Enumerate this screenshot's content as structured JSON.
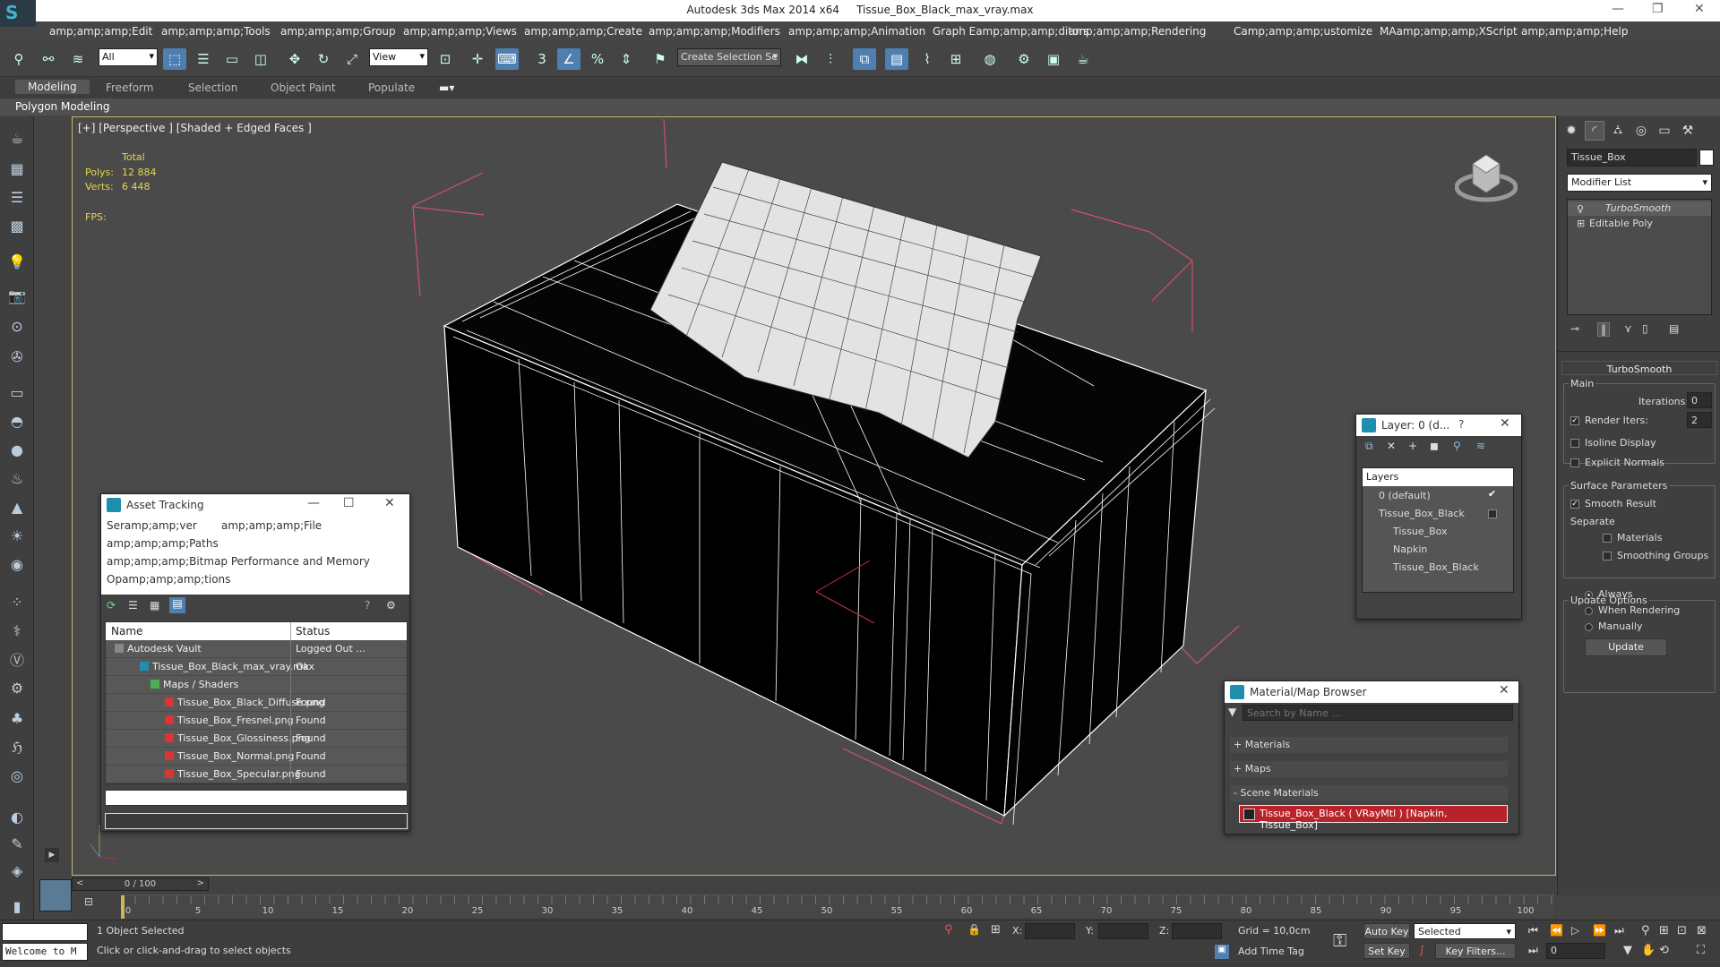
{
  "window": {
    "app_title": "Autodesk 3ds Max  2014 x64",
    "file_title": "Tissue_Box_Black_max_vray.max"
  },
  "menu": [
    "amp;amp;amp;Edit",
    "amp;amp;amp;Tools",
    "amp;amp;amp;Group",
    "amp;amp;amp;Views",
    "amp;amp;amp;Create",
    "amp;amp;amp;Modifiers",
    "amp;amp;amp;Animation",
    "Graph Eamp;amp;amp;ditors",
    "amp;amp;amp;Rendering",
    "Camp;amp;amp;ustomize",
    "MAamp;amp;amp;XScript",
    "amp;amp;amp;Help"
  ],
  "toolbar": {
    "filter_value": "All",
    "refcoord_value": "View",
    "selection_set_placeholder": "Create Selection Se"
  },
  "ribbon": {
    "tabs": [
      "Modeling",
      "Freeform",
      "Selection",
      "Object Paint",
      "Populate"
    ],
    "sub_label": "Polygon Modeling"
  },
  "viewport": {
    "label": "[+] [Perspective ] [Shaded + Edged Faces ]",
    "stats_total_label": "Total",
    "polys_label": "Polys:",
    "polys_value": "12 884",
    "verts_label": "Verts:",
    "verts_value": "6 448",
    "fps_label": "FPS:"
  },
  "command_panel": {
    "object_name": "Tissue_Box",
    "modifier_list_label": "Modifier List",
    "stack": [
      "TurboSmooth",
      "Editable Poly"
    ],
    "rollout_title": "TurboSmooth",
    "main_label": "Main",
    "iterations_label": "Iterations:",
    "iterations_value": "0",
    "render_iters_label": "Render Iters:",
    "render_iters_value": "2",
    "isoline_label": "Isoline Display",
    "explicit_normals_label": "Explicit Normals",
    "surface_params_label": "Surface Parameters",
    "smooth_result_label": "Smooth Result",
    "separate_label": "Separate",
    "materials_label": "Materials",
    "smoothing_groups_label": "Smoothing Groups",
    "update_options_label": "Update Options",
    "always_label": "Always",
    "when_rendering_label": "When Rendering",
    "manually_label": "Manually",
    "update_button": "Update"
  },
  "asset_tracking": {
    "title": "Asset Tracking",
    "menu_line1a": "Seramp;amp;ver",
    "menu_line1b": "amp;amp;amp;File",
    "menu_line2": "amp;amp;amp;Paths",
    "menu_line3": "amp;amp;amp;Bitmap Performance and Memory",
    "menu_line4": "Opamp;amp;amp;tions",
    "col_name": "Name",
    "col_status": "Status",
    "rows": [
      {
        "name": "Autodesk Vault",
        "status": "Logged Out ..."
      },
      {
        "name": "Tissue_Box_Black_max_vray.max",
        "status": "Ok"
      },
      {
        "name": "Maps / Shaders",
        "status": ""
      },
      {
        "name": "Tissue_Box_Black_Diffuse.png",
        "status": "Found"
      },
      {
        "name": "Tissue_Box_Fresnel.png",
        "status": "Found"
      },
      {
        "name": "Tissue_Box_Glossiness.png",
        "status": "Found"
      },
      {
        "name": "Tissue_Box_Normal.png",
        "status": "Found"
      },
      {
        "name": "Tissue_Box_Specular.png",
        "status": "Found"
      }
    ]
  },
  "layer_panel": {
    "title": "Layer: 0 (d...",
    "help": "?",
    "header": "Layers",
    "items": [
      "0 (default)",
      "Tissue_Box_Black",
      "Tissue_Box",
      "Napkin",
      "Tissue_Box_Black"
    ]
  },
  "material_browser": {
    "title": "Material/Map Browser",
    "search_placeholder": "Search by Name ...",
    "materials": "+ Materials",
    "maps": "+ Maps",
    "scene_materials": "- Scene Materials",
    "scene_item": "Tissue_Box_Black  ( VRayMtl )  [Napkin, Tissue_Box]"
  },
  "timeline": {
    "frame_label": "0 / 100",
    "ticks": [
      "0",
      "5",
      "10",
      "15",
      "20",
      "25",
      "30",
      "35",
      "40",
      "45",
      "50",
      "55",
      "60",
      "65",
      "70",
      "75",
      "80",
      "85",
      "90",
      "95",
      "100"
    ]
  },
  "status": {
    "maxscript": "Welcome to M",
    "selected": "1 Object Selected",
    "prompt": "Click or click-and-drag to select objects",
    "x_label": "X:",
    "y_label": "Y:",
    "z_label": "Z:",
    "grid": "Grid = 10,0cm",
    "add_time_tag": "Add Time Tag",
    "auto_key": "Auto Key",
    "set_key": "Set Key",
    "selected_value": "Selected",
    "key_filters": "Key Filters...",
    "frame_value": "0"
  },
  "colors": {
    "accent": "#4e7fb0",
    "viewport_border": "#c7b860",
    "stats": "#e8d34a",
    "scene_item": "#b8222a"
  }
}
